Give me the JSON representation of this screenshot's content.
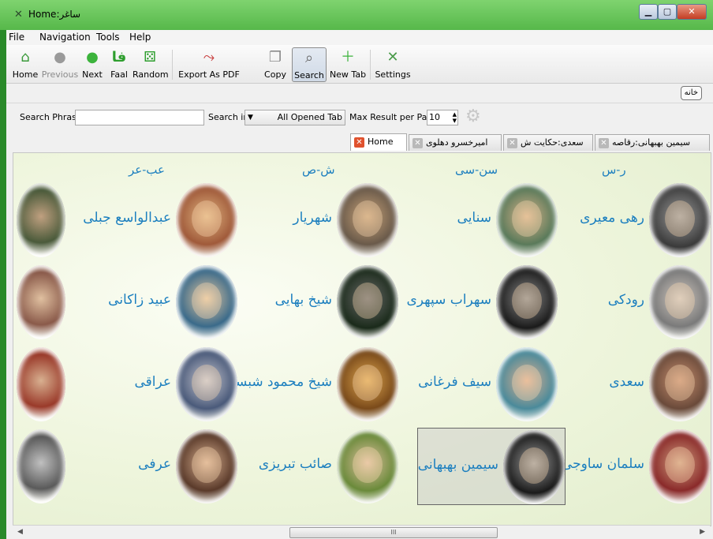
{
  "window": {
    "title": "Home:ساغر"
  },
  "menu": [
    "File",
    "Navigation",
    "Tools",
    "Help"
  ],
  "toolbar": {
    "home": "Home",
    "previous": "Previous",
    "next": "Next",
    "faal": "Faal",
    "random": "Random",
    "export": "Export As PDF",
    "copy": "Copy",
    "search": "Search",
    "newtab": "New Tab",
    "settings": "Settings"
  },
  "bar2": {
    "home_button": "خانه"
  },
  "searchbar": {
    "phrase_label": "Search Phrase",
    "phrase_value": "",
    "search_in_label": "Search in",
    "search_in_value": "All Opened Tab",
    "max_label": "Max Result per Page",
    "max_value": "10"
  },
  "tabs": [
    {
      "label": "Home",
      "active": true
    },
    {
      "label": "امیرخسرو دهلوی",
      "active": false
    },
    {
      "label": "سعدی:حکایت ش",
      "active": false
    },
    {
      "label": "سیمین بهبهانی:رقاصه",
      "active": false
    }
  ],
  "columns": [
    "ر-س",
    "سن-سی",
    "ش-ص",
    "عب-عر"
  ],
  "poets": [
    [
      "رهی معیری",
      "سنایی",
      "شهریار",
      "عبدالواسع جبلی"
    ],
    [
      "رودکی",
      "سهراب سپهری",
      "شیخ بهایی",
      "عبید زاکانی"
    ],
    [
      "سعدی",
      "سیف فرغانی",
      "شیخ محمود شبستری",
      "عراقی"
    ],
    [
      "سلمان ساوجی",
      "سیمین بهبهانی",
      "صائب تبریزی",
      "عرفی"
    ]
  ],
  "selected_poet": "سیمین بهبهانی",
  "scrollbar": {
    "thumb_label": "III"
  }
}
